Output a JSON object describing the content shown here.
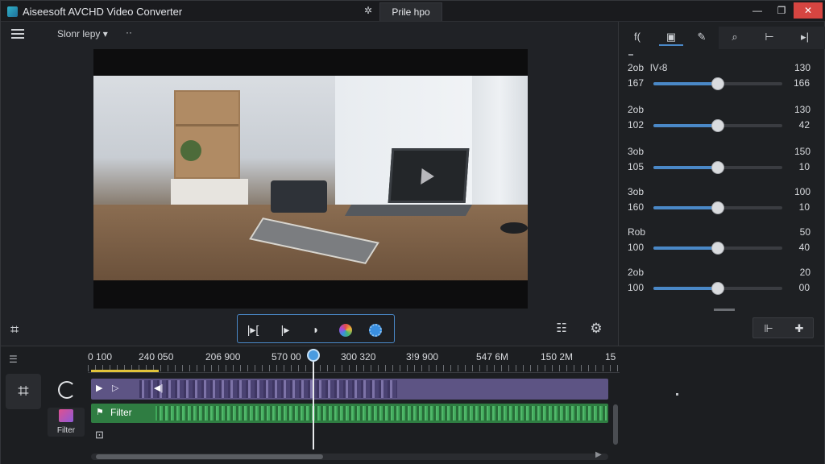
{
  "titlebar": {
    "app_title": "Aiseesoft AVCHD Video Converter",
    "tab_label": "Prile hpo",
    "minimize_glyph": "—",
    "maximize_glyph": "❐",
    "close_glyph": "✕"
  },
  "toolbar": {
    "preset_label": "Slonr lepy ▾",
    "more_label": "··"
  },
  "preview_controls": {
    "trim_in_glyph": "|▸[",
    "trim_out_glyph": "|▸",
    "split_glyph": "◗"
  },
  "right_panel": {
    "tabs": [
      "f(",
      "▣",
      "✎",
      "⌕",
      "⊢",
      "▸|"
    ],
    "active_tab": 1,
    "rows": [
      {
        "top_left": "2ob",
        "top_sub": "lV‹8",
        "top_right": "130",
        "bot_left": "167",
        "bot_right": "166",
        "level": 0.5
      },
      {
        "top_left": "2ob",
        "top_sub": "",
        "top_right": "130",
        "bot_left": "102",
        "bot_right": "42",
        "level": 0.5
      },
      {
        "top_left": "3ob",
        "top_sub": "",
        "top_right": "150",
        "bot_left": "105",
        "bot_right": "10",
        "level": 0.5
      },
      {
        "top_left": "3ob",
        "top_sub": "",
        "top_right": "100",
        "bot_left": "160",
        "bot_right": "10",
        "level": 0.5
      },
      {
        "top_left": "Rob",
        "top_sub": "",
        "top_right": "50",
        "bot_left": "100",
        "bot_right": "40",
        "level": 0.5
      },
      {
        "top_left": "2ob",
        "top_sub": "",
        "top_right": "20",
        "bot_left": "100",
        "bot_right": "00",
        "level": 0.5
      }
    ],
    "split_glyph": "⊩",
    "pin_glyph": "✚"
  },
  "timeline": {
    "menu_glyph": "☰",
    "ruler_labels": [
      "0 100",
      "240 050",
      "206 900",
      "570 00",
      "300 320",
      "3!9 900",
      "547 6M",
      "150 2M",
      "15"
    ],
    "filter_label": "Filter",
    "audio_track_label": "Filter",
    "add_glyph": "⊡"
  }
}
